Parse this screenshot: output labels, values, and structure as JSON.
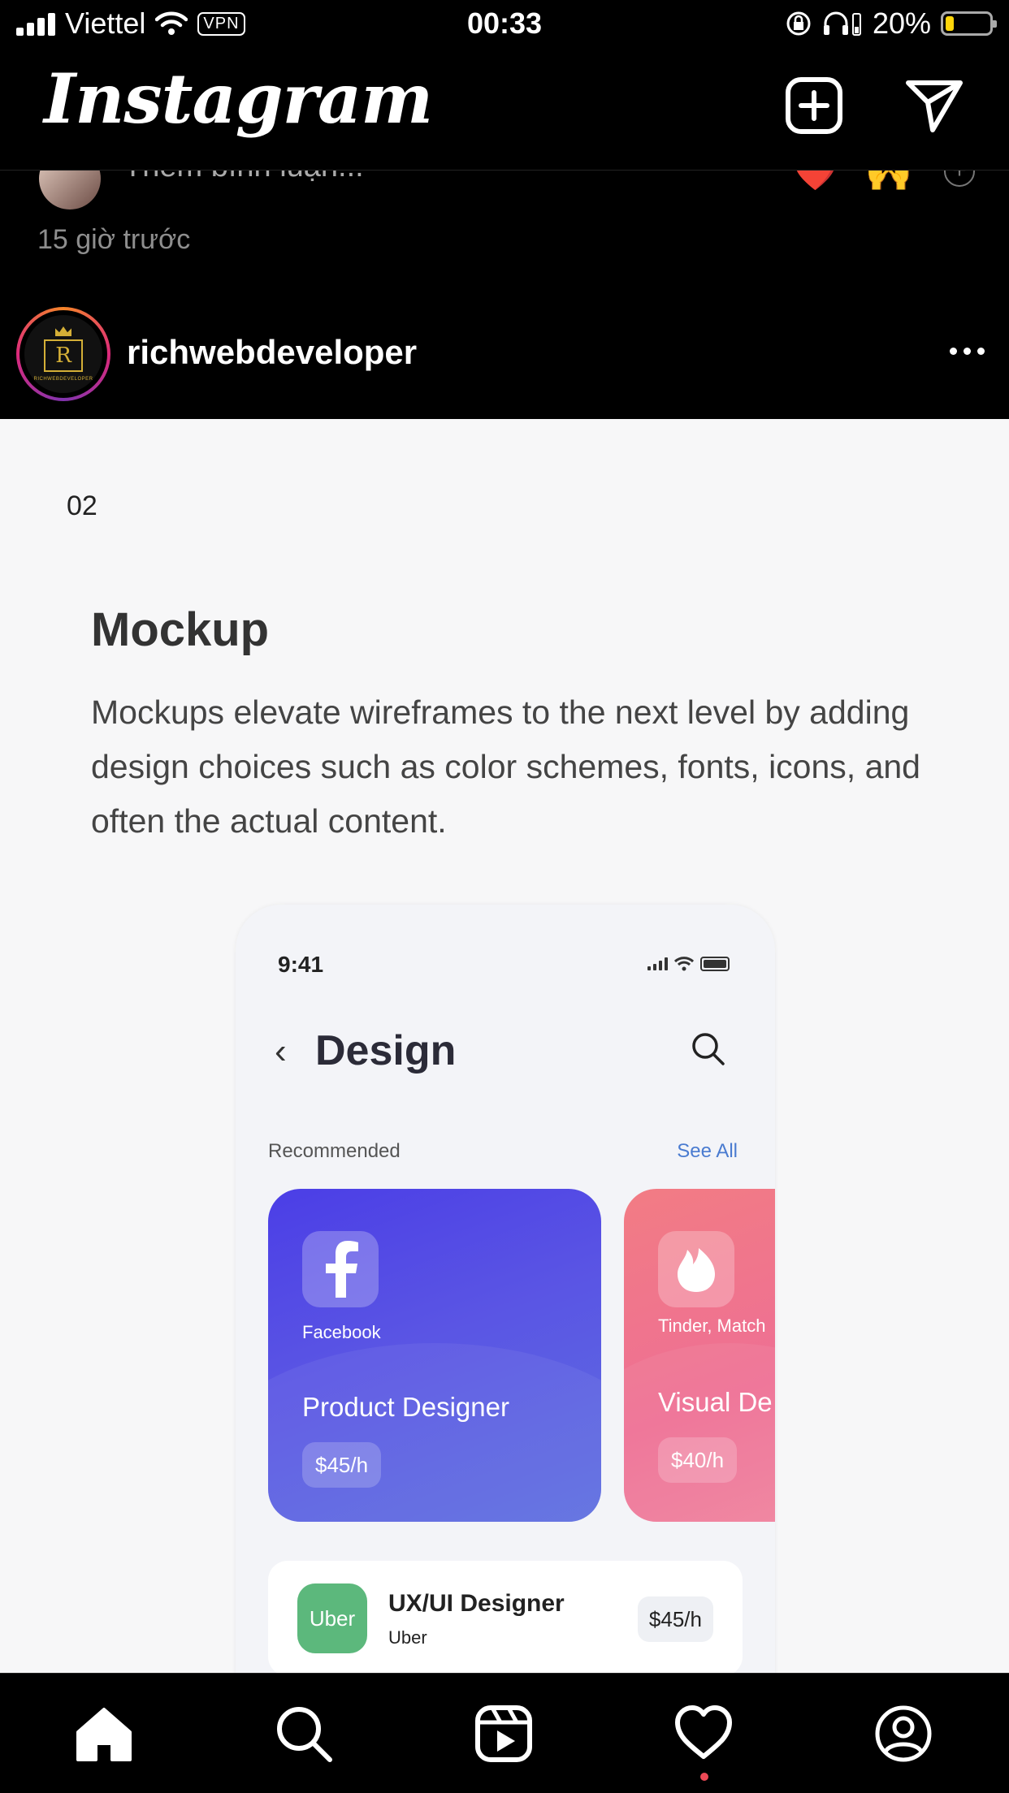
{
  "status_bar": {
    "carrier": "Viettel",
    "vpn": "VPN",
    "time": "00:33",
    "battery": "20%",
    "battery_level": 0.2
  },
  "header": {
    "logo": "Instagram",
    "icons": [
      "new-post-icon",
      "direct-message-icon"
    ]
  },
  "previous_post": {
    "comment_placeholder": "Thêm bình luận...",
    "reactions": [
      "❤️",
      "🙌"
    ],
    "timestamp": "15 giờ trước"
  },
  "post": {
    "username": "richwebdeveloper",
    "avatar_text": "R",
    "avatar_subtext": "RICHWEBDEVELOPER",
    "image": {
      "number": "02",
      "title": "Mockup",
      "description": "Mockups elevate wireframes to the next level by adding design choices such as color schemes, fonts, icons, and often the actual content.",
      "mockup": {
        "time": "9:41",
        "screen_title": "Design",
        "section_label": "Recommended",
        "see_all": "See All",
        "cards": [
          {
            "company": "Facebook",
            "role": "Product Designer",
            "rate": "$45/h",
            "color": "#4b3ee6"
          },
          {
            "company": "Tinder, Match",
            "role": "Visual De",
            "rate": "$40/h",
            "color": "#f27c84"
          }
        ],
        "job": {
          "logo": "Uber",
          "title": "UX/UI Designer",
          "company": "Uber",
          "rate": "$45/h"
        }
      }
    }
  },
  "bottom_nav": {
    "items": [
      "home-icon",
      "search-icon",
      "reels-icon",
      "activity-icon",
      "profile-icon"
    ],
    "notification_color": "#ed4956"
  }
}
